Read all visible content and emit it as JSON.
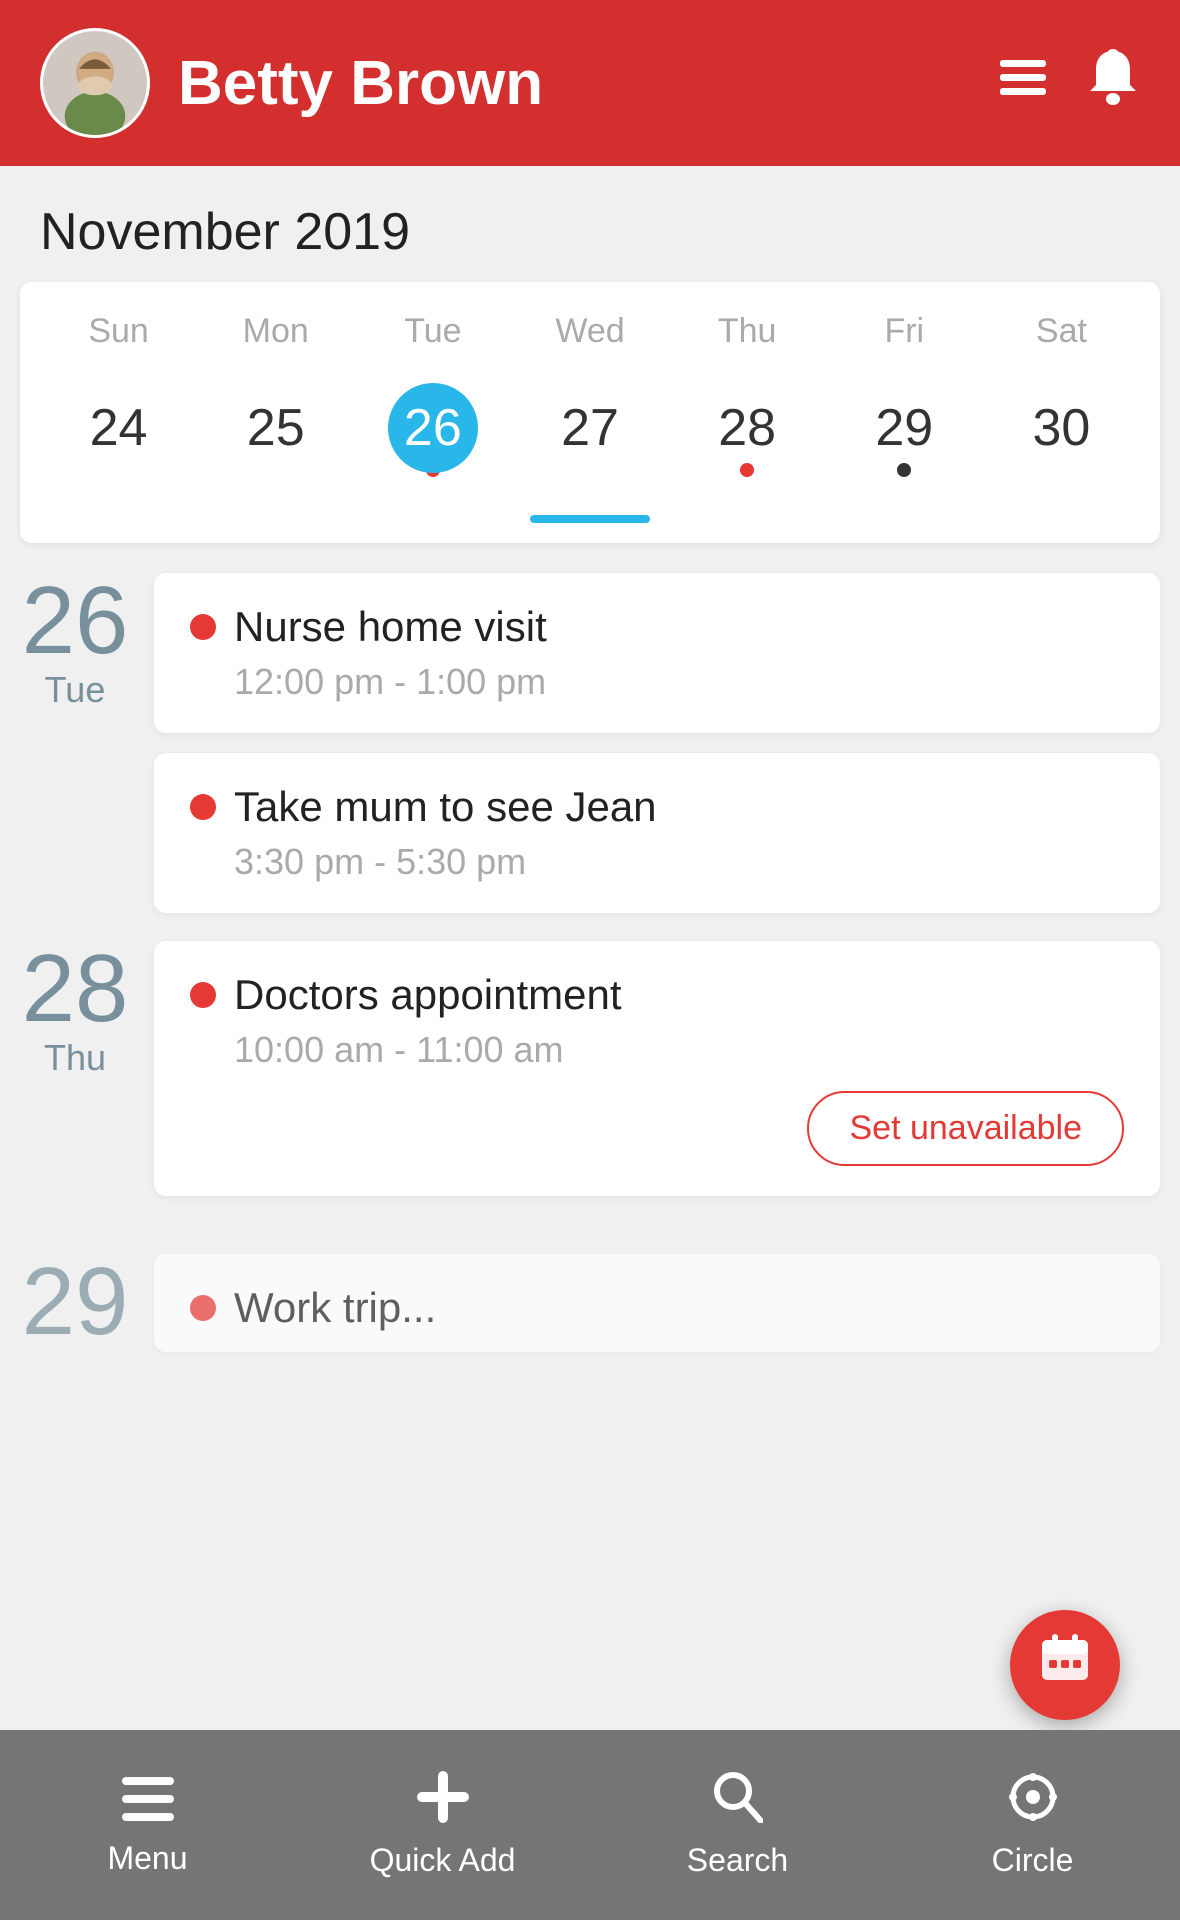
{
  "header": {
    "user_name": "Betty Brown",
    "menu_icon": "☰",
    "bell_icon": "🔔"
  },
  "calendar": {
    "month_year": "November 2019",
    "day_names": [
      "Sun",
      "Mon",
      "Tue",
      "Wed",
      "Thu",
      "Fri",
      "Sat"
    ],
    "dates": [
      {
        "num": "24",
        "today": false,
        "dot": "none"
      },
      {
        "num": "25",
        "today": false,
        "dot": "none"
      },
      {
        "num": "26",
        "today": true,
        "dot": "red"
      },
      {
        "num": "27",
        "today": false,
        "dot": "none"
      },
      {
        "num": "28",
        "today": false,
        "dot": "red"
      },
      {
        "num": "29",
        "today": false,
        "dot": "black"
      },
      {
        "num": "30",
        "today": false,
        "dot": "none"
      }
    ]
  },
  "events": [
    {
      "date_num": "26",
      "day_name": "Tue",
      "cards": [
        {
          "title": "Nurse home visit",
          "time": "12:00 pm - 1:00 pm",
          "show_unavailable": false
        },
        {
          "title": "Take mum to see Jean",
          "time": "3:30 pm - 5:30 pm",
          "show_unavailable": false
        }
      ]
    },
    {
      "date_num": "28",
      "day_name": "Thu",
      "cards": [
        {
          "title": "Doctors appointment",
          "time": "10:00 am - 11:00 am",
          "show_unavailable": true
        }
      ]
    }
  ],
  "partial_event": {
    "date_num": "29",
    "title": "Work trip..."
  },
  "bottom_nav": {
    "items": [
      {
        "label": "Menu",
        "icon": "≡"
      },
      {
        "label": "Quick Add",
        "icon": "+"
      },
      {
        "label": "Search",
        "icon": "🔍"
      },
      {
        "label": "Circle",
        "icon": "⚙"
      }
    ]
  },
  "buttons": {
    "set_unavailable": "Set unavailable"
  }
}
